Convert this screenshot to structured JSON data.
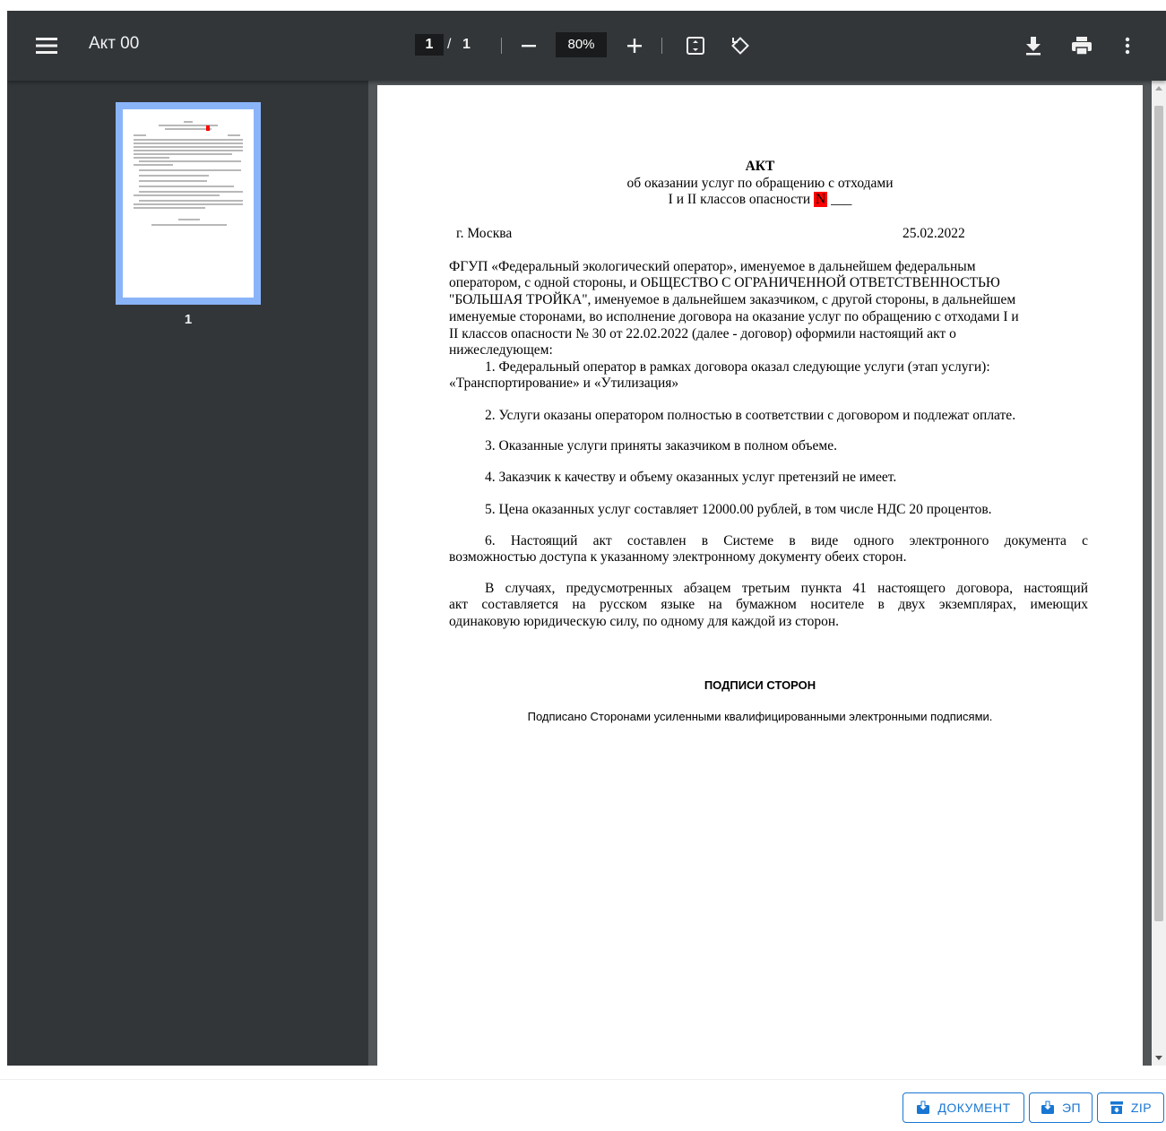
{
  "toolbar": {
    "title": "Акт 00",
    "page_current": "1",
    "page_separator": "/",
    "page_total": "1",
    "zoom": "80%"
  },
  "sidebar": {
    "thumbnail_label": "1"
  },
  "document": {
    "title": "АКТ",
    "subtitle1": "об оказании услуг по обращению с отходами",
    "subtitle2": "I и II классов опасности",
    "number_mark": "N",
    "number_blank": "___",
    "city": "г. Москва",
    "date": "25.02.2022",
    "intro_lines": [
      "ФГУП «Федеральный экологический оператор», именуемое в дальнейшем федеральным",
      "оператором, с одной стороны, и ОБЩЕСТВО С ОГРАНИЧЕННОЙ ОТВЕТСТВЕННОСТЬЮ",
      "\"БОЛЬШАЯ ТРОЙКА\", именуемое в дальнейшем заказчиком, с другой стороны, в дальнейшем",
      "именуемые сторонами, во исполнение договора на оказание услуг по обращению с отходами I и",
      "II классов опасности № 30 от 22.02.2022 (далее - договор) оформили настоящий акт о",
      "нижеследующем:"
    ],
    "item1_line1": "1. Федеральный оператор в рамках договора оказал следующие услуги (этап услуги):",
    "item1_line2": "«Транспортирование» и «Утилизация»",
    "item2": "2. Услуги оказаны оператором полностью в соответствии с договором и подлежат оплате.",
    "item3": "3. Оказанные услуги приняты заказчиком в полном объеме.",
    "item4": "4. Заказчик к качеству и объему оказанных услуг претензий не имеет.",
    "item5": "5. Цена оказанных услуг составляет 12000.00 рублей, в том числе НДС 20 процентов.",
    "item6_line1": "6. Настоящий акт составлен в Системе в виде одного электронного документа с",
    "item6_line2": "возможностью доступа к указанному электронному документу обеих сторон.",
    "para_line1": "В случаях, предусмотренных абзацем третьим пункта 41 настоящего договора, настоящий",
    "para_line2": "акт составляется на русском языке на бумажном носителе в двух экземплярах, имеющих",
    "para_line3": "одинаковую юридическую силу, по одному для каждой из сторон.",
    "signatures_title": "ПОДПИСИ СТОРОН",
    "signatures_text": "Подписано Сторонами усиленными квалифицированными электронными подписями."
  },
  "buttons": {
    "document": "ДОКУМЕНТ",
    "ep": "ЭП",
    "zip": "ZIP"
  },
  "colors": {
    "toolbar_bg": "#323639",
    "viewer_bg": "#525659",
    "thumbnail_border": "#8ab4f8",
    "accent": "#1976d2",
    "mark_red": "#ff0000"
  }
}
